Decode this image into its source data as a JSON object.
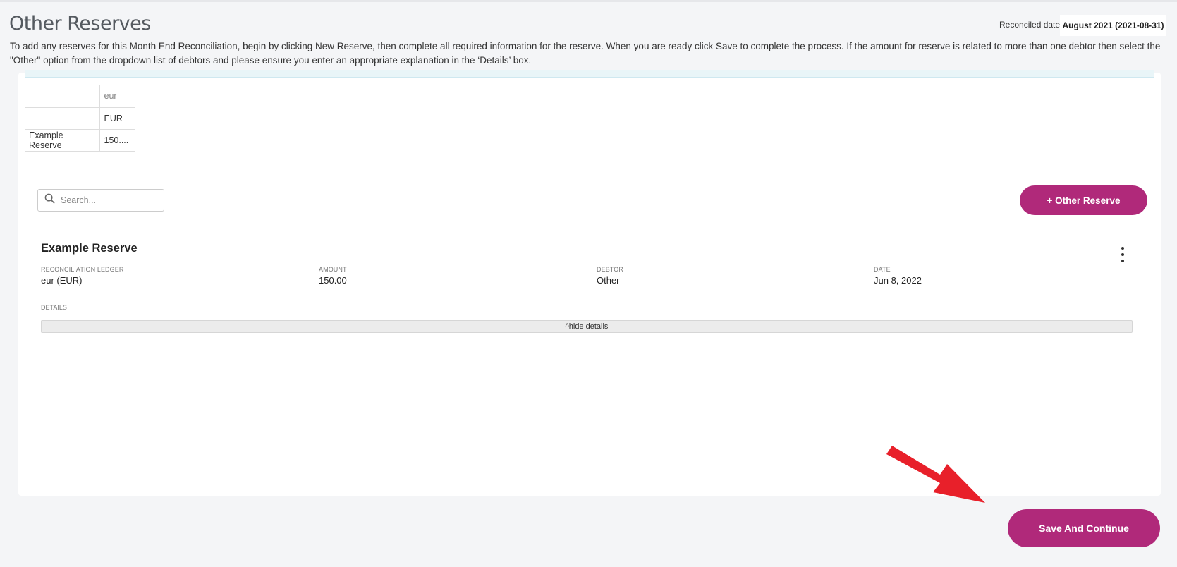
{
  "page": {
    "title": "Other Reserves",
    "reconciled_label": "Reconciled date",
    "reconciled_value": "August 2021 (2021-08-31)",
    "instructions": "To add any reserves for this Month End Reconciliation, begin by clicking New Reserve, then complete all required information for the reserve. When you are ready click Save to complete the process. If the amount for reserve is related to more than one debtor then select the \"Other\" option from the dropdown list of debtors and please ensure you enter an appropriate explanation in the ‘Details’ box."
  },
  "summary_table": {
    "header": [
      "",
      "eur"
    ],
    "rows": [
      [
        "",
        "EUR"
      ],
      [
        "Example Reserve",
        "150...."
      ]
    ]
  },
  "search": {
    "placeholder": "Search..."
  },
  "add_button": {
    "label": "+ Other Reserve"
  },
  "reserve": {
    "title": "Example Reserve",
    "fields": [
      {
        "label": "RECONCILIATION LEDGER",
        "value": "eur (EUR)"
      },
      {
        "label": "AMOUNT",
        "value": "150.00"
      },
      {
        "label": "DEBTOR",
        "value": "Other"
      },
      {
        "label": "DATE",
        "value": "Jun 8, 2022"
      }
    ],
    "details_label": "DETAILS",
    "hide_details_label": "^hide details"
  },
  "footer": {
    "save_label": "Save And Continue"
  },
  "colors": {
    "accent": "#b0297a",
    "annotation_arrow": "#e8202a"
  }
}
